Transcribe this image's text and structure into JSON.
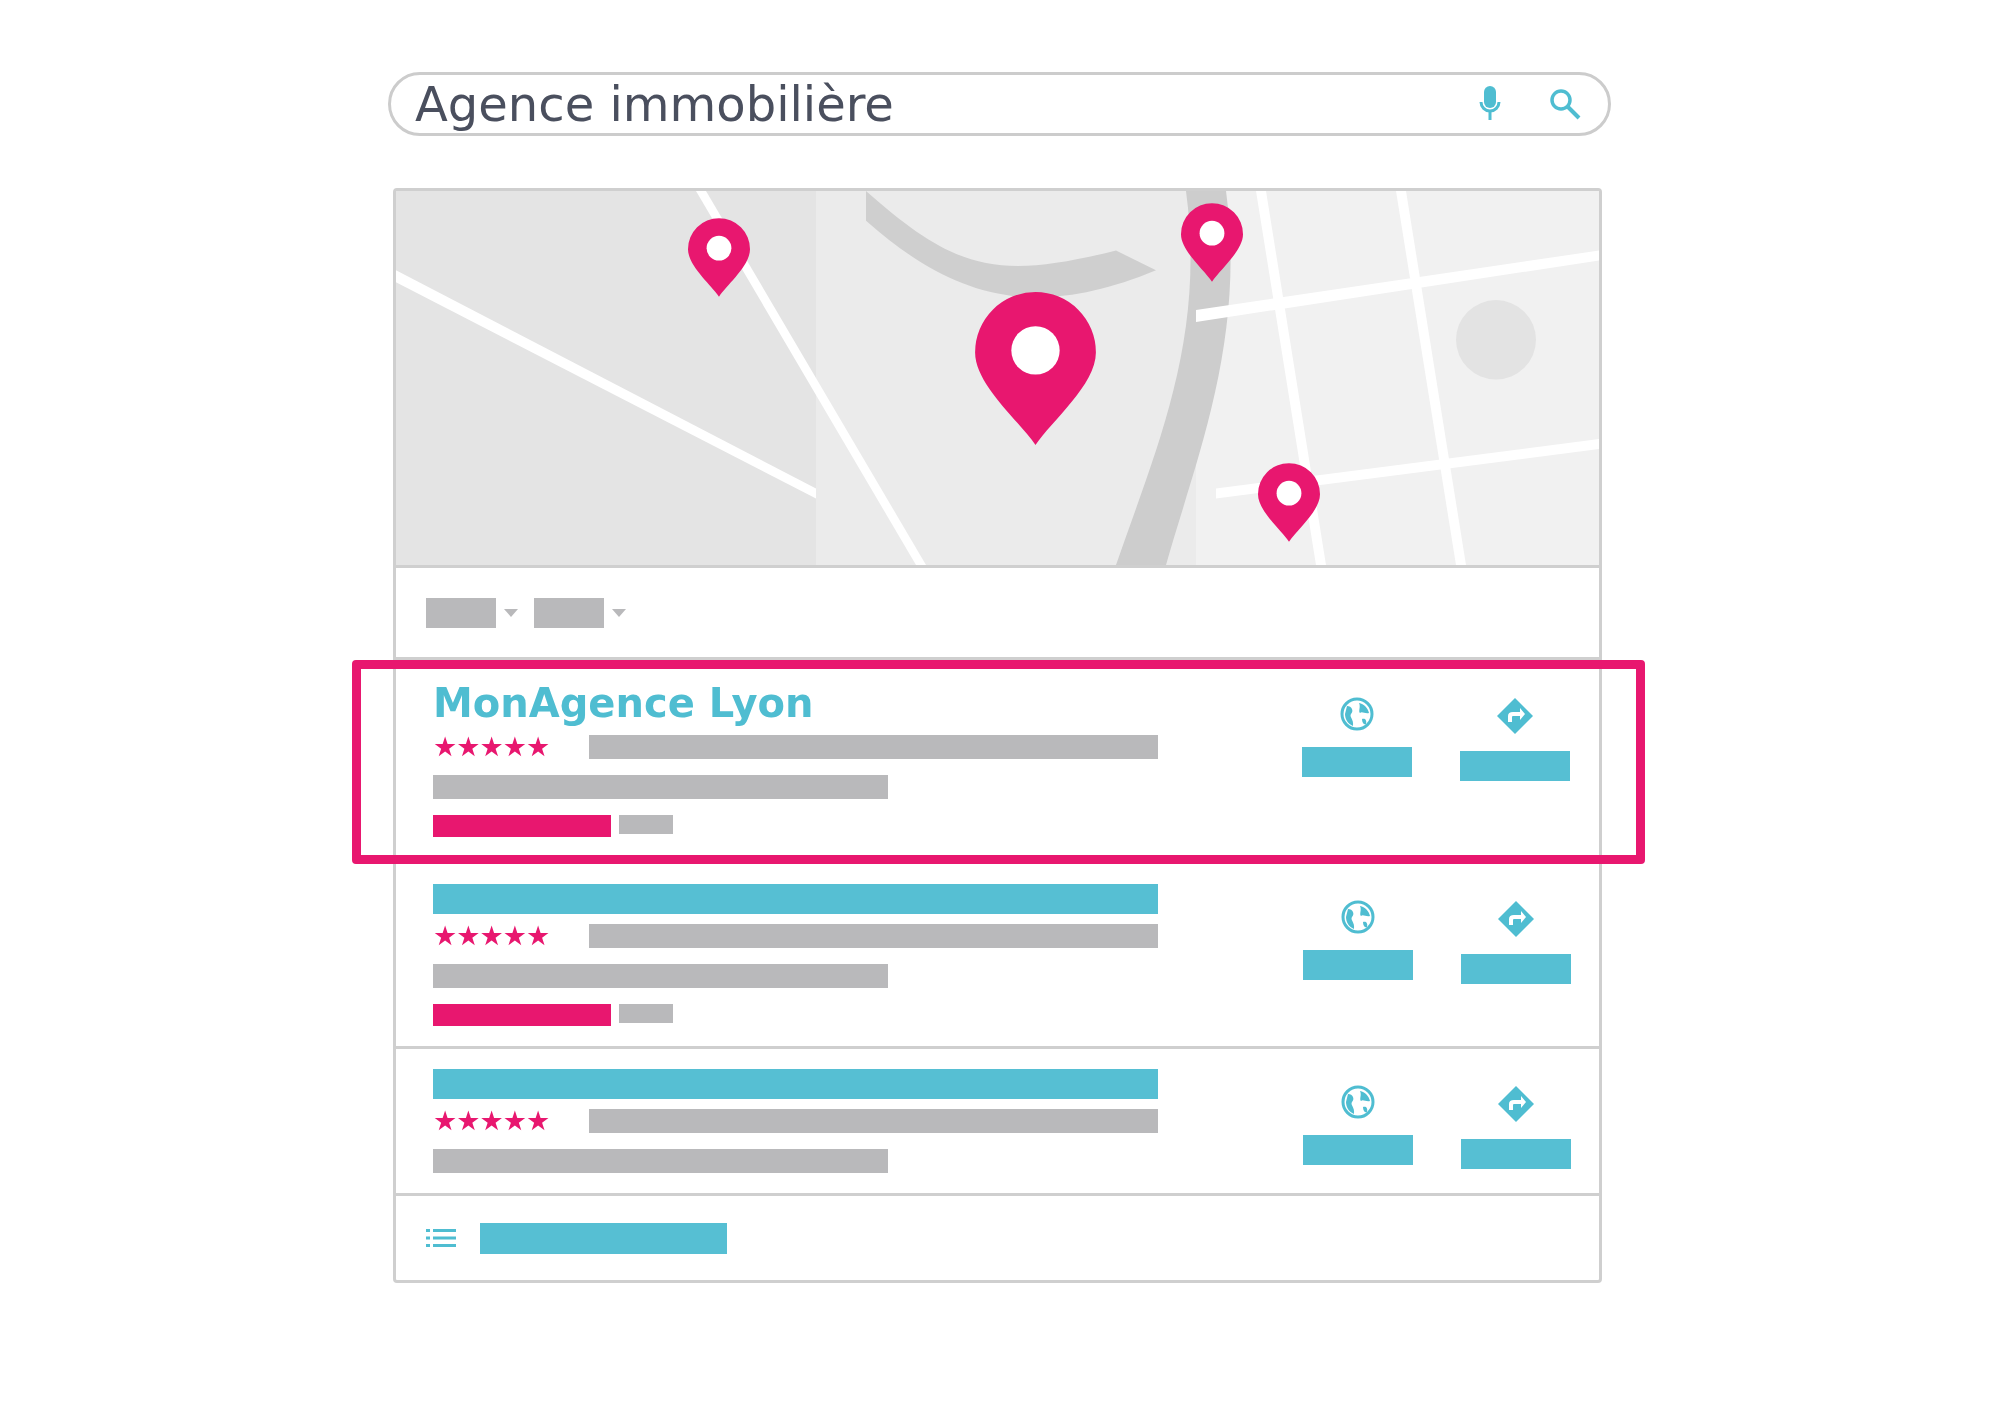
{
  "search": {
    "value": "Agence immobilière"
  },
  "results": [
    {
      "title": "MonAgence Lyon",
      "stars": 5,
      "selected": true,
      "kind": "with-tag"
    },
    {
      "stars": 5,
      "selected": false,
      "kind": "with-tag"
    },
    {
      "stars": 5,
      "selected": false,
      "kind": "plain"
    }
  ]
}
